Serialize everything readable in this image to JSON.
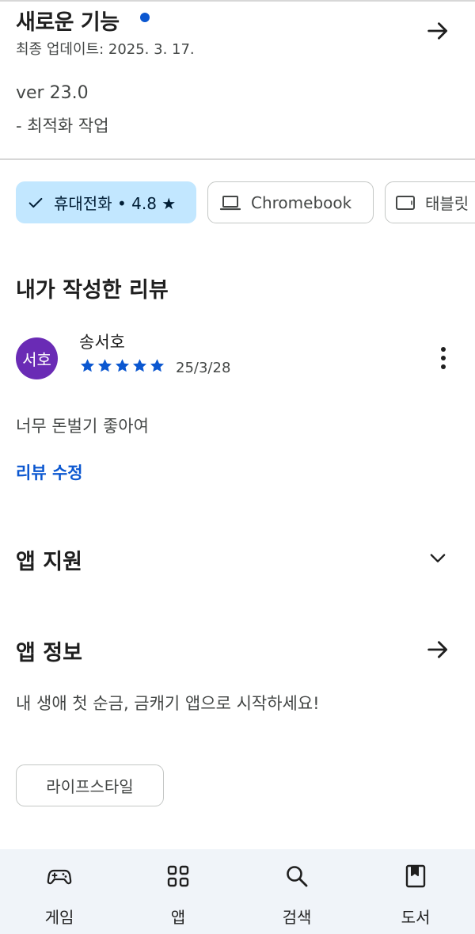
{
  "whats_new": {
    "title": "새로운 기능",
    "last_updated": "최종 업데이트: 2025. 3. 17.",
    "version": "ver 23.0",
    "notes": "- 최적화 작업"
  },
  "device_chips": [
    {
      "label": "휴대전화 • 4.8 ★",
      "selected": true
    },
    {
      "label": "Chromebook",
      "selected": false
    },
    {
      "label": "태블릿",
      "selected": false
    }
  ],
  "my_review": {
    "section_title": "내가 작성한 리뷰",
    "avatar_text": "서호",
    "reviewer_name": "송서호",
    "rating": 5,
    "date": "25/3/28",
    "body": "너무 돈벌기 좋아여",
    "edit_label": "리뷰 수정"
  },
  "app_support": {
    "title": "앱 지원"
  },
  "about_app": {
    "title": "앱 정보",
    "description": "내 생애 첫 순금, 금캐기 앱으로 시작하세요!",
    "category": "라이프스타일"
  },
  "bottom_nav": [
    {
      "label": "게임",
      "icon": "gamepad-icon"
    },
    {
      "label": "앱",
      "icon": "apps-grid-icon"
    },
    {
      "label": "검색",
      "icon": "search-icon"
    },
    {
      "label": "도서",
      "icon": "bookmark-book-icon"
    }
  ],
  "colors": {
    "accent": "#0b57d0",
    "selected_chip": "#c2e7ff",
    "avatar": "#6a2bb5",
    "nav_background": "#f0f4f9"
  }
}
